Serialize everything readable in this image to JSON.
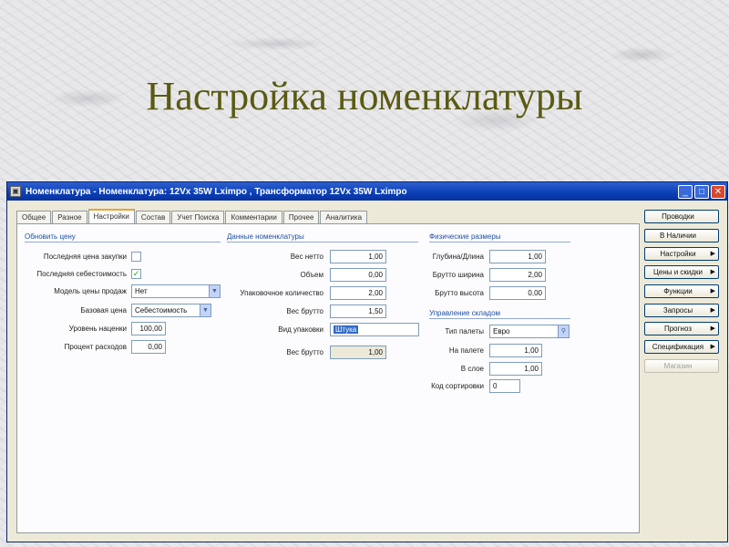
{
  "slide": {
    "title": "Настройка номенклатуры"
  },
  "window": {
    "title": "Номенклатура - Номенклатура: 12Vx 35W Lximpo , Трансформатор 12Vx 35W Lximpo",
    "controls": {
      "minimize": "_",
      "maximize": "□",
      "close": "✕"
    }
  },
  "tabs": [
    "Общее",
    "Разное",
    "Настройки",
    "Состав",
    "Учет Поиска",
    "Комментарии",
    "Прочее",
    "Аналитика"
  ],
  "active_tab": "Настройки",
  "pricing": {
    "section_title": "Обновить цену",
    "last_purchase_price_label": "Последняя цена закупки",
    "last_purchase_price_checked": false,
    "last_cost_label": "Последняя себестоимость",
    "last_cost_checked": true,
    "sales_price_model_label": "Модель цены продаж",
    "sales_price_model_value": "Нет",
    "base_price_label": "Базовая цена",
    "base_price_value": "Себестоимость",
    "markup_label": "Уровень наценки",
    "markup_value": "100,00",
    "expense_percent_label": "Процент расходов",
    "expense_percent_value": "0,00"
  },
  "item_data": {
    "section_title": "Данные номенклатуры",
    "weight_label": "Вес нетто",
    "weight_value": "1,00",
    "volume_label": "Объем",
    "volume_value": "0,00",
    "pack_qty_label": "Упаковочное количество",
    "pack_qty_value": "2,00",
    "gross_weight_label": "Вес брутто",
    "gross_weight_value": "1,50",
    "pack_type_label": "Вид упаковки",
    "pack_type_value": "Штука",
    "gross_weight2_label": "Вес брутто",
    "gross_weight2_value": "1,00"
  },
  "dimensions": {
    "section_title": "Физические размеры",
    "depth_label": "Глубина/Длина",
    "depth_value": "1,00",
    "width_label": "Брутто ширина",
    "width_value": "2,00",
    "height_label": "Брутто высота",
    "height_value": "0,00"
  },
  "warehouse": {
    "section_title": "Управление складом",
    "pallet_type_label": "Тип палеты",
    "pallet_type_value": "Евро",
    "per_pallet_label": "На палете",
    "per_pallet_value": "1,00",
    "per_layer_label": "В слое",
    "per_layer_value": "1,00",
    "sort_code_label": "Код сортировки",
    "sort_code_value": "0"
  },
  "side_buttons": [
    {
      "label": "Проводки",
      "arrow": ""
    },
    {
      "label": "В Наличии",
      "arrow": ""
    },
    {
      "label": "Настройки",
      "arrow": "▶"
    },
    {
      "label": "Цены и скидки",
      "arrow": "▶"
    },
    {
      "label": "Функции",
      "arrow": "▶"
    },
    {
      "label": "Запросы",
      "arrow": "▶"
    },
    {
      "label": "Прогноз",
      "arrow": "▶"
    },
    {
      "label": "Спецификация",
      "arrow": "▶"
    },
    {
      "label": "Магазин",
      "arrow": ""
    }
  ]
}
